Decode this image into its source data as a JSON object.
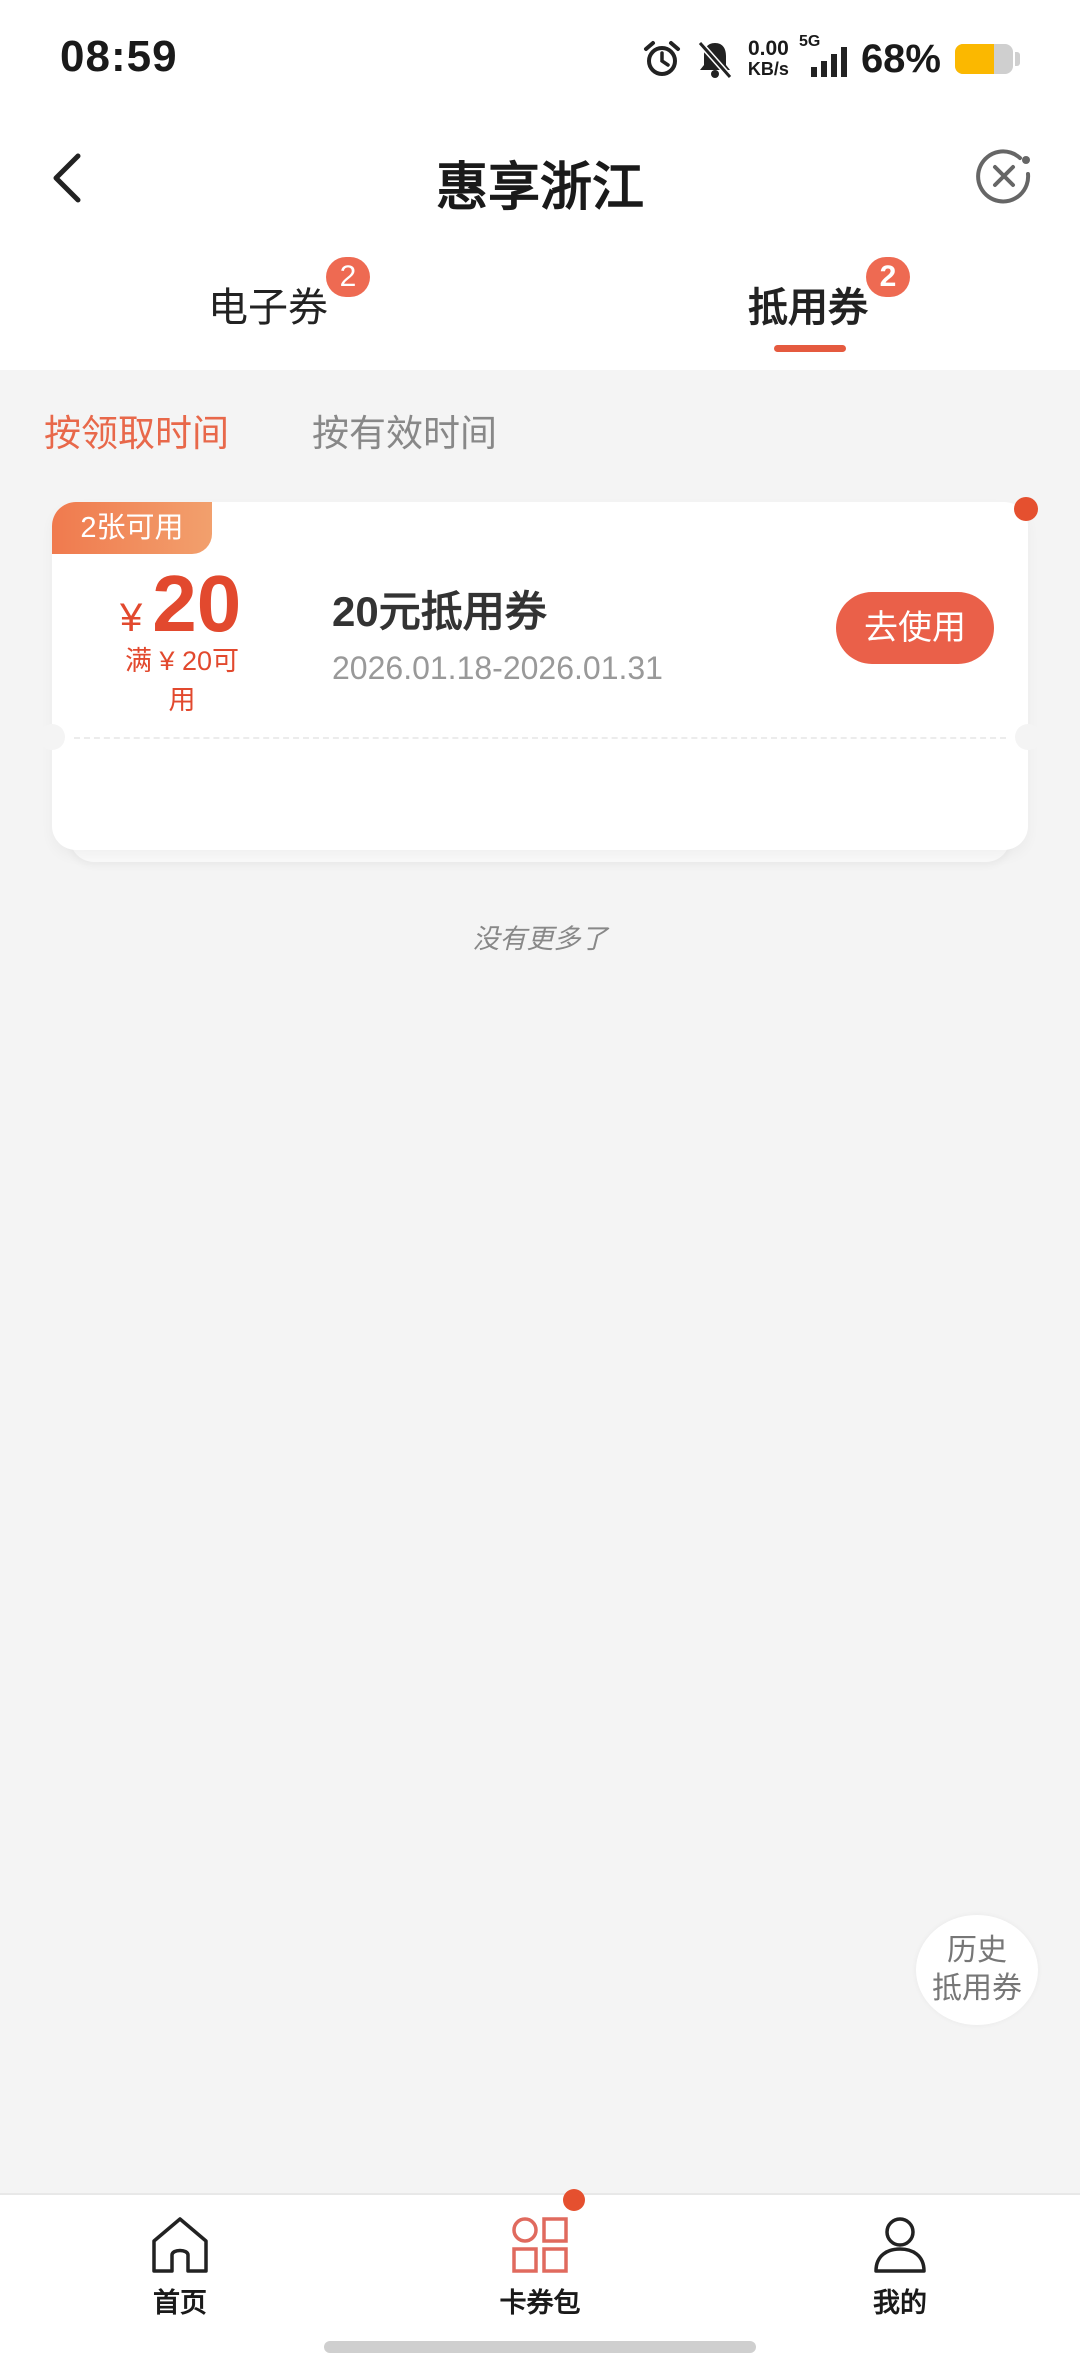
{
  "status_bar": {
    "time": "08:59",
    "net_speed_value": "0.00",
    "net_speed_unit": "KB/s",
    "network": "5G",
    "battery_percent": "68%",
    "battery_level": 0.68,
    "icons": [
      "alarm-icon",
      "bell-muted-icon",
      "signal-icon",
      "battery-icon"
    ]
  },
  "header": {
    "title": "惠享浙江",
    "back_icon": "chevron-left-icon",
    "close_icon": "close-circle-icon"
  },
  "tabs": [
    {
      "label": "电子券",
      "badge": "2",
      "active": false
    },
    {
      "label": "抵用券",
      "badge": "2",
      "active": true
    }
  ],
  "sort": [
    {
      "label": "按领取时间",
      "active": true
    },
    {
      "label": "按有效时间",
      "active": false
    }
  ],
  "coupon": {
    "tag": "2张可用",
    "currency": "¥",
    "amount": "20",
    "condition": "满 ¥ 20可用",
    "name": "20元抵用券",
    "date_range": "2026.01.18-2026.01.31",
    "action": "去使用"
  },
  "list_end_text": "没有更多了",
  "history_button": {
    "line1": "历史",
    "line2": "抵用券"
  },
  "bottom_nav": [
    {
      "label": "首页",
      "icon": "home-icon",
      "active": false
    },
    {
      "label": "卡券包",
      "icon": "grid-icon",
      "active": true
    },
    {
      "label": "我的",
      "icon": "user-icon",
      "active": false
    }
  ],
  "colors": {
    "accent": "#e55a3f",
    "badge": "#ee6a52",
    "price": "#e2492e",
    "battery": "#fbb800"
  }
}
